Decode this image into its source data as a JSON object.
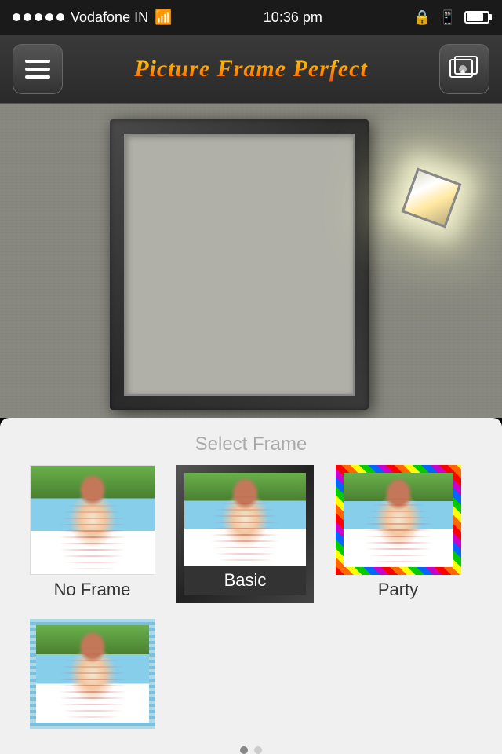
{
  "statusBar": {
    "carrier": "Vodafone IN",
    "time": "10:36 pm",
    "signalDots": 5,
    "wifi": true,
    "lock": true,
    "bluetooth": true,
    "battery": 80
  },
  "toolbar": {
    "title": "Picture Frame Perfect",
    "menuIcon": "menu-icon",
    "galleryIcon": "gallery-icon"
  },
  "mainArea": {
    "description": "Frame preview area with wall background"
  },
  "bottomPanel": {
    "selectFrameLabel": "Select Frame",
    "frames": [
      {
        "id": "no-frame",
        "label": "No Frame",
        "type": "no-frame",
        "selected": false
      },
      {
        "id": "basic",
        "label": "Basic",
        "type": "basic",
        "selected": true
      },
      {
        "id": "party",
        "label": "Party",
        "type": "party",
        "selected": false
      },
      {
        "id": "wave",
        "label": "",
        "type": "wave",
        "selected": false
      }
    ]
  }
}
